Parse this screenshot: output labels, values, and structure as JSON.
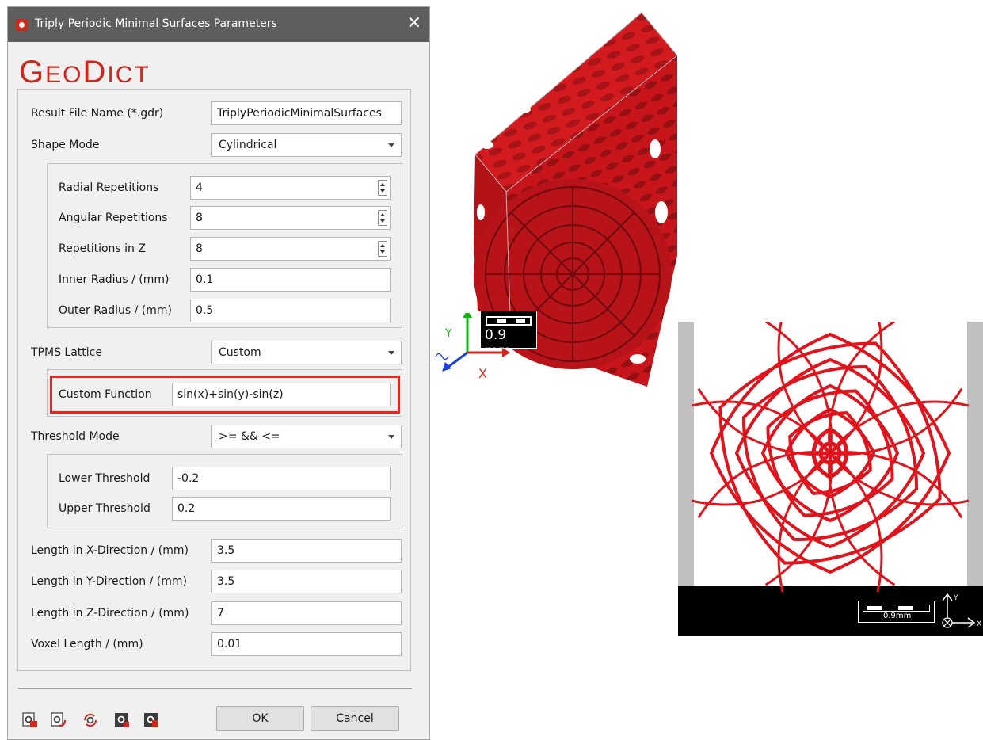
{
  "window": {
    "title": "Triply Periodic Minimal Surfaces Parameters",
    "close_glyph": "✕"
  },
  "logo": {
    "part1_big": "G",
    "part1_small": "EO",
    "part2_big": "D",
    "part2_small": "ICT"
  },
  "fields": {
    "result_file": {
      "label": "Result File Name (*.gdr)",
      "value": "TriplyPeriodicMinimalSurfaces"
    },
    "shape_mode": {
      "label": "Shape Mode",
      "value": "Cylindrical"
    },
    "radial_repetitions": {
      "label": "Radial Repetitions",
      "value": "4"
    },
    "angular_repetitions": {
      "label": "Angular Repetitions",
      "value": "8"
    },
    "repetitions_z": {
      "label": "Repetitions in Z",
      "value": "8"
    },
    "inner_radius": {
      "label": "Inner Radius / (mm)",
      "value": "0.1"
    },
    "outer_radius": {
      "label": "Outer Radius / (mm)",
      "value": "0.5"
    },
    "tpms_lattice": {
      "label": "TPMS Lattice",
      "value": "Custom"
    },
    "custom_function": {
      "label": "Custom Function",
      "value": "sin(x)+sin(y)-sin(z)"
    },
    "threshold_mode": {
      "label": "Threshold Mode",
      "value": ">= && <="
    },
    "lower_threshold": {
      "label": "Lower Threshold",
      "value": "-0.2"
    },
    "upper_threshold": {
      "label": "Upper Threshold",
      "value": "0.2"
    },
    "length_x": {
      "label": "Length in X-Direction / (mm)",
      "value": "3.5"
    },
    "length_y": {
      "label": "Length in Y-Direction / (mm)",
      "value": "3.5"
    },
    "length_z": {
      "label": "Length in Z-Direction / (mm)",
      "value": "7"
    },
    "voxel_length": {
      "label": "Voxel Length / (mm)",
      "value": "0.01"
    }
  },
  "buttons": {
    "ok": "OK",
    "cancel": "Cancel"
  },
  "toolbar_icons": [
    "load-parameters-icon",
    "save-parameters-icon",
    "reset-parameters-icon",
    "info-icon",
    "macro-icon"
  ],
  "view3d": {
    "scale_label": "0.9 mm",
    "axis_labels": {
      "x": "X",
      "y": "Y"
    }
  },
  "view2d": {
    "scale_label": "0.9mm",
    "axis_labels": {
      "x": "X",
      "y": "Y"
    }
  },
  "colors": {
    "accent": "#d0271b",
    "highlight": "#e52620",
    "structure": "#c8141b",
    "titlebar": "#5e5e5e"
  }
}
